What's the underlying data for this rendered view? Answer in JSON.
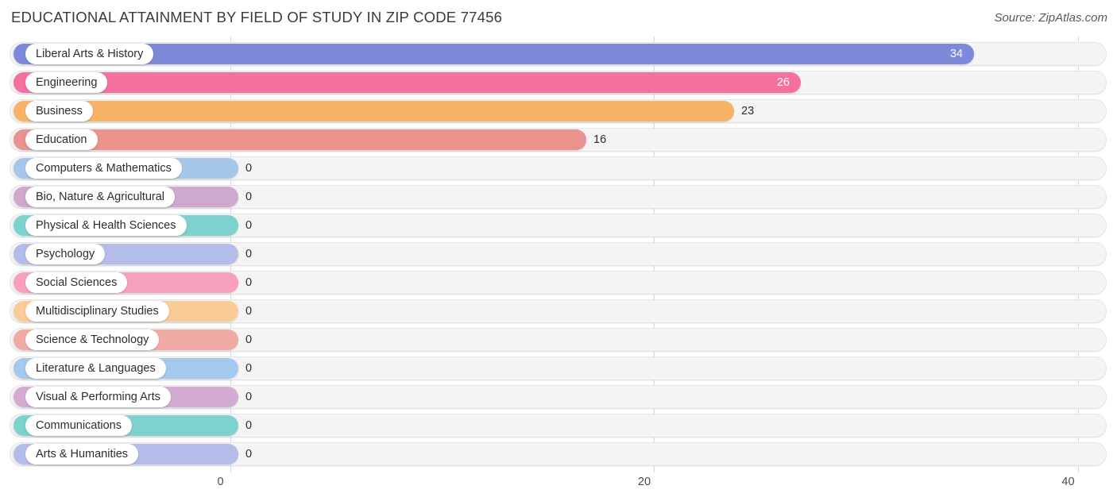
{
  "header": {
    "title": "EDUCATIONAL ATTAINMENT BY FIELD OF STUDY IN ZIP CODE 77456",
    "source": "Source: ZipAtlas.com"
  },
  "axis": {
    "ticks": [
      "0",
      "20",
      "40"
    ],
    "tick_values": [
      0,
      20,
      40
    ]
  },
  "chart_data": {
    "type": "bar",
    "orientation": "horizontal",
    "title": "EDUCATIONAL ATTAINMENT BY FIELD OF STUDY IN ZIP CODE 77456",
    "subtitle": "Source: ZipAtlas.com",
    "xlabel": "",
    "ylabel": "",
    "xlim": [
      0,
      40
    ],
    "xticks": [
      0,
      20,
      40
    ],
    "grid": true,
    "legend": false,
    "categories": [
      "Liberal Arts & History",
      "Engineering",
      "Business",
      "Education",
      "Computers & Mathematics",
      "Bio, Nature & Agricultural",
      "Physical & Health Sciences",
      "Psychology",
      "Social Sciences",
      "Multidisciplinary Studies",
      "Science & Technology",
      "Literature & Languages",
      "Visual & Performing Arts",
      "Communications",
      "Arts & Humanities"
    ],
    "values": [
      34,
      26,
      23,
      16,
      0,
      0,
      0,
      0,
      0,
      0,
      0,
      0,
      0,
      0,
      0
    ],
    "value_labels": [
      "34",
      "26",
      "23",
      "16",
      "0",
      "0",
      "0",
      "0",
      "0",
      "0",
      "0",
      "0",
      "0",
      "0",
      "0"
    ],
    "colors": [
      "#7d8ada",
      "#f4709e",
      "#f7b268",
      "#ec928c",
      "#a7c7ea",
      "#cfa8cd",
      "#7dd2cd",
      "#b4bcea",
      "#f6a0bd",
      "#fbcb97",
      "#f0aaa4",
      "#a4c9ef",
      "#d3abd3",
      "#7dd2cd",
      "#b4bcea"
    ]
  },
  "rows": [
    {
      "label": "Liberal Arts & History",
      "value": "34",
      "color": "#7d8ada",
      "bar_end": 1226,
      "label_inside": true
    },
    {
      "label": "Engineering",
      "value": "26",
      "color": "#f4709e",
      "bar_end": 1008,
      "label_inside": true
    },
    {
      "label": "Business",
      "value": "23",
      "color": "#f7b268",
      "bar_end": 924,
      "label_inside": false
    },
    {
      "label": "Education",
      "value": "16",
      "color": "#ec928c",
      "bar_end": 738,
      "label_inside": false
    },
    {
      "label": "Computers & Mathematics",
      "value": "0",
      "color": "#a7c7ea",
      "bar_end": 300,
      "label_inside": false
    },
    {
      "label": "Bio, Nature & Agricultural",
      "value": "0",
      "color": "#cfa8cd",
      "bar_end": 300,
      "label_inside": false
    },
    {
      "label": "Physical & Health Sciences",
      "value": "0",
      "color": "#7dd2cd",
      "bar_end": 300,
      "label_inside": false
    },
    {
      "label": "Psychology",
      "value": "0",
      "color": "#b4bcea",
      "bar_end": 300,
      "label_inside": false
    },
    {
      "label": "Social Sciences",
      "value": "0",
      "color": "#f6a0bd",
      "bar_end": 300,
      "label_inside": false
    },
    {
      "label": "Multidisciplinary Studies",
      "value": "0",
      "color": "#fbcb97",
      "bar_end": 300,
      "label_inside": false
    },
    {
      "label": "Science & Technology",
      "value": "0",
      "color": "#f0aaa4",
      "bar_end": 300,
      "label_inside": false
    },
    {
      "label": "Literature & Languages",
      "value": "0",
      "color": "#a4c9ef",
      "bar_end": 300,
      "label_inside": false
    },
    {
      "label": "Visual & Performing Arts",
      "value": "0",
      "color": "#d3abd3",
      "bar_end": 300,
      "label_inside": false
    },
    {
      "label": "Communications",
      "value": "0",
      "color": "#7dd2cd",
      "bar_end": 300,
      "label_inside": false
    },
    {
      "label": "Arts & Humanities",
      "value": "0",
      "color": "#b4bcea",
      "bar_end": 300,
      "label_inside": false
    }
  ]
}
